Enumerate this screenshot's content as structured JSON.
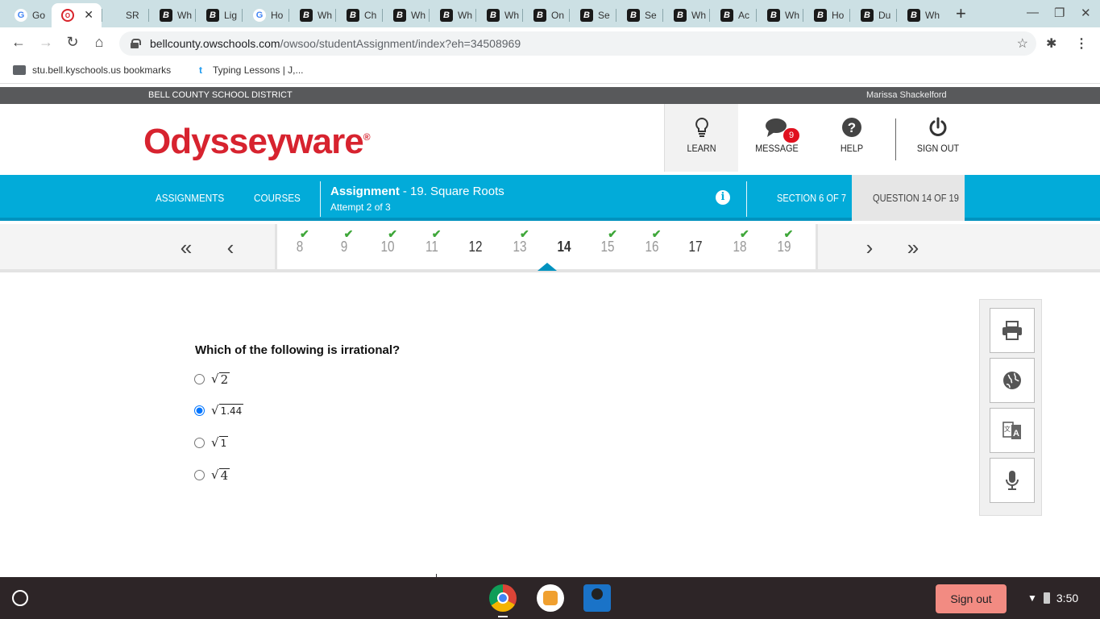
{
  "browser": {
    "tabs": [
      {
        "label": "Go",
        "favicon": "G",
        "kind": "google"
      },
      {
        "label": "",
        "favicon": "O",
        "kind": "odyssey",
        "active": true
      },
      {
        "label": "SR",
        "favicon": "",
        "kind": "none"
      },
      {
        "label": "Wh",
        "favicon": "B",
        "kind": "b"
      },
      {
        "label": "Lig",
        "favicon": "B",
        "kind": "b"
      },
      {
        "label": "Ho",
        "favicon": "G",
        "kind": "google"
      },
      {
        "label": "Wh",
        "favicon": "B",
        "kind": "b"
      },
      {
        "label": "Ch",
        "favicon": "B",
        "kind": "b"
      },
      {
        "label": "Wh",
        "favicon": "B",
        "kind": "b"
      },
      {
        "label": "Wh",
        "favicon": "B",
        "kind": "b"
      },
      {
        "label": "Wh",
        "favicon": "B",
        "kind": "b"
      },
      {
        "label": "On",
        "favicon": "B",
        "kind": "b"
      },
      {
        "label": "Se",
        "favicon": "B",
        "kind": "b"
      },
      {
        "label": "Se",
        "favicon": "B",
        "kind": "b"
      },
      {
        "label": "Wh",
        "favicon": "B",
        "kind": "b"
      },
      {
        "label": "Ac",
        "favicon": "B",
        "kind": "b"
      },
      {
        "label": "Wh",
        "favicon": "B",
        "kind": "b"
      },
      {
        "label": "Ho",
        "favicon": "B",
        "kind": "b"
      },
      {
        "label": "Du",
        "favicon": "B",
        "kind": "b"
      },
      {
        "label": "Wh",
        "favicon": "B",
        "kind": "b"
      }
    ],
    "url_host": "bellcounty.owschools.com",
    "url_path": "/owsoo/studentAssignment/index?eh=34508969",
    "bookmarks": [
      {
        "label": "stu.bell.kyschools.us bookmarks",
        "icon": "folder-icon"
      },
      {
        "label": "Typing Lessons | J,...",
        "icon": "t"
      }
    ]
  },
  "district": {
    "name": "BELL COUNTY SCHOOL DISTRICT",
    "user": "Marissa Shackelford"
  },
  "header": {
    "logo": "Odysseyware",
    "logo_mark": "®",
    "nav": {
      "learn": "LEARN",
      "message": "MESSAGE",
      "message_count": "9",
      "help": "HELP",
      "signout": "SIGN OUT"
    }
  },
  "bluebar": {
    "assignments": "ASSIGNMENTS",
    "courses": "COURSES",
    "assignment_label": "Assignment",
    "assignment_name": "- 19. Square Roots",
    "attempt": "Attempt 2 of 3",
    "section": "SECTION 6 OF 7",
    "question": "QUESTION 14 OF 19"
  },
  "questions": [
    {
      "num": "8",
      "checked": true,
      "style": "light"
    },
    {
      "num": "9",
      "checked": true,
      "style": "light"
    },
    {
      "num": "10",
      "checked": true,
      "style": "light"
    },
    {
      "num": "11",
      "checked": true,
      "style": "light"
    },
    {
      "num": "12",
      "checked": false,
      "style": "dark"
    },
    {
      "num": "13",
      "checked": true,
      "style": "light"
    },
    {
      "num": "14",
      "checked": false,
      "style": "current"
    },
    {
      "num": "15",
      "checked": true,
      "style": "light"
    },
    {
      "num": "16",
      "checked": true,
      "style": "light"
    },
    {
      "num": "17",
      "checked": false,
      "style": "dark"
    },
    {
      "num": "18",
      "checked": true,
      "style": "light"
    },
    {
      "num": "19",
      "checked": true,
      "style": "light"
    }
  ],
  "question": {
    "prompt": "Which of the following is irrational?",
    "choices": [
      {
        "radicand": "2",
        "selected": false,
        "small": false
      },
      {
        "radicand": "1.44",
        "selected": true,
        "small": true
      },
      {
        "radicand": "1",
        "selected": false,
        "small": true
      },
      {
        "radicand": "4",
        "selected": false,
        "small": false
      }
    ]
  },
  "taskbar": {
    "signout": "Sign out",
    "time": "3:50"
  },
  "colors": {
    "brand_red": "#d7232f",
    "bar_blue": "#02abd9",
    "check_green": "#3fa73a",
    "signout_pink": "#f28b82"
  }
}
